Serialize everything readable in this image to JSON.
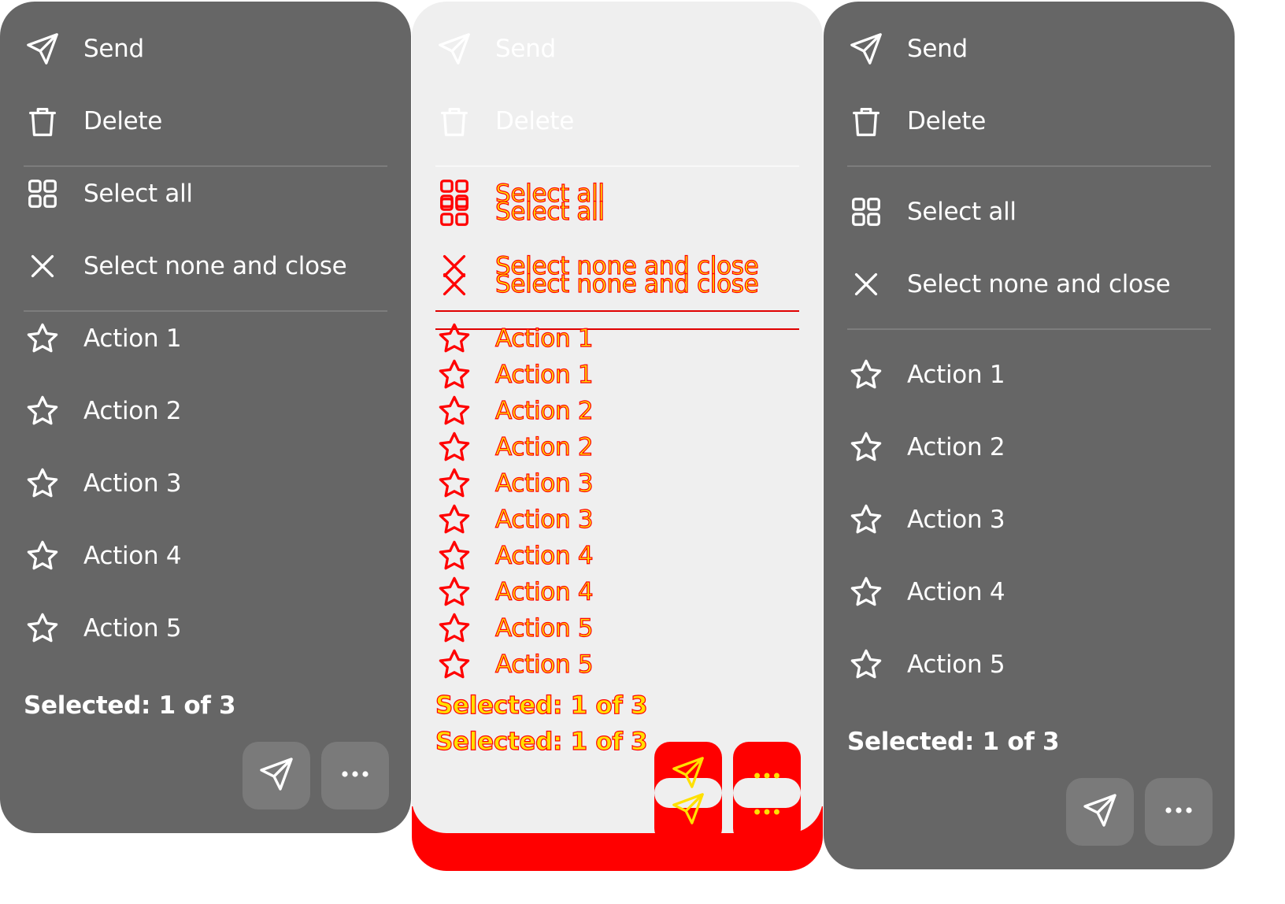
{
  "menu": {
    "send_label": "Send",
    "delete_label": "Delete",
    "select_all_label": "Select all",
    "select_none_label": "Select none and close",
    "actions": [
      "Action 1",
      "Action 2",
      "Action 3",
      "Action 4",
      "Action 5"
    ],
    "selected_text": "Selected: 1 of 3"
  },
  "icons": {
    "send": "send-icon",
    "delete": "trash-icon",
    "select_all": "grid-icon",
    "select_none": "close-icon",
    "action": "star-icon",
    "more": "more-dots-icon"
  },
  "colors": {
    "panel_bg": "#666666",
    "text": "#ffffff",
    "button_bg": "#7a7a7a",
    "ghost_panel_bg": "#efefef",
    "overlay_red": "#ff0000",
    "overlay_yellow": "#ffe000"
  }
}
